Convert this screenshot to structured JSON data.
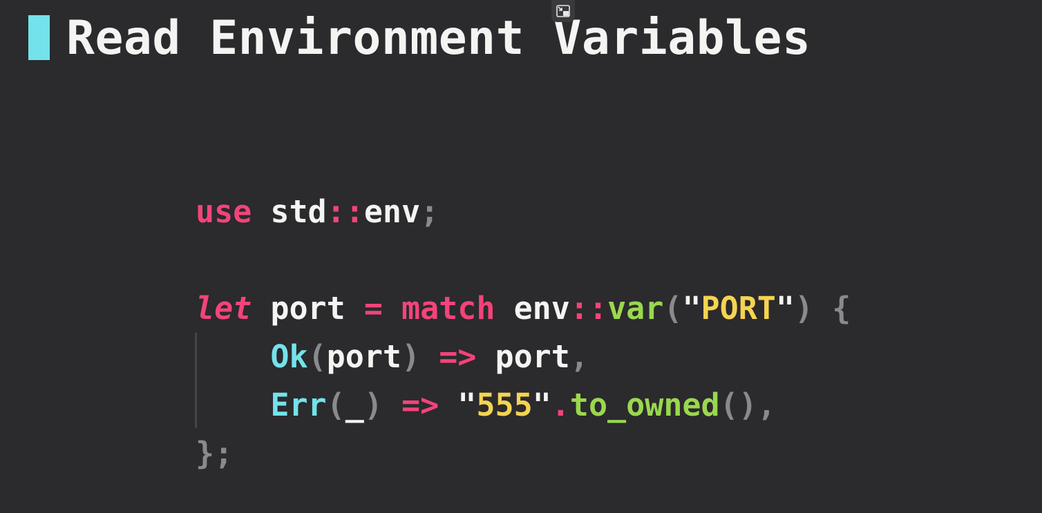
{
  "slide": {
    "title": "Read Environment Variables"
  },
  "toolbar": {
    "pip_icon": "exit-picture-in-picture-icon"
  },
  "code": {
    "line1": {
      "use": "use",
      "std": " std",
      "sep": "::",
      "env": "env",
      "semi": ";"
    },
    "line3": {
      "let": "let",
      "port": " port ",
      "eq": "=",
      "match": " match",
      "env": " env",
      "sep": "::",
      "var": "var",
      "lparen": "(",
      "q1": "\"",
      "port_str": "PORT",
      "q2": "\"",
      "rparen": ")",
      "brace": " {"
    },
    "line4": {
      "indent": "    ",
      "ok": "Ok",
      "lparen": "(",
      "port": "port",
      "rparen": ")",
      "arrow": " =>",
      "port2": " port",
      "comma": ","
    },
    "line5": {
      "indent": "    ",
      "err": "Err",
      "lparen": "(",
      "underscore": "_",
      "rparen": ")",
      "arrow": " =>",
      "q1": " \"",
      "num": "555",
      "q2": "\"",
      "dot": ".",
      "method": "to_owned",
      "parens": "()",
      "comma": ","
    },
    "line6": {
      "brace": "}",
      "semi": ";"
    }
  }
}
